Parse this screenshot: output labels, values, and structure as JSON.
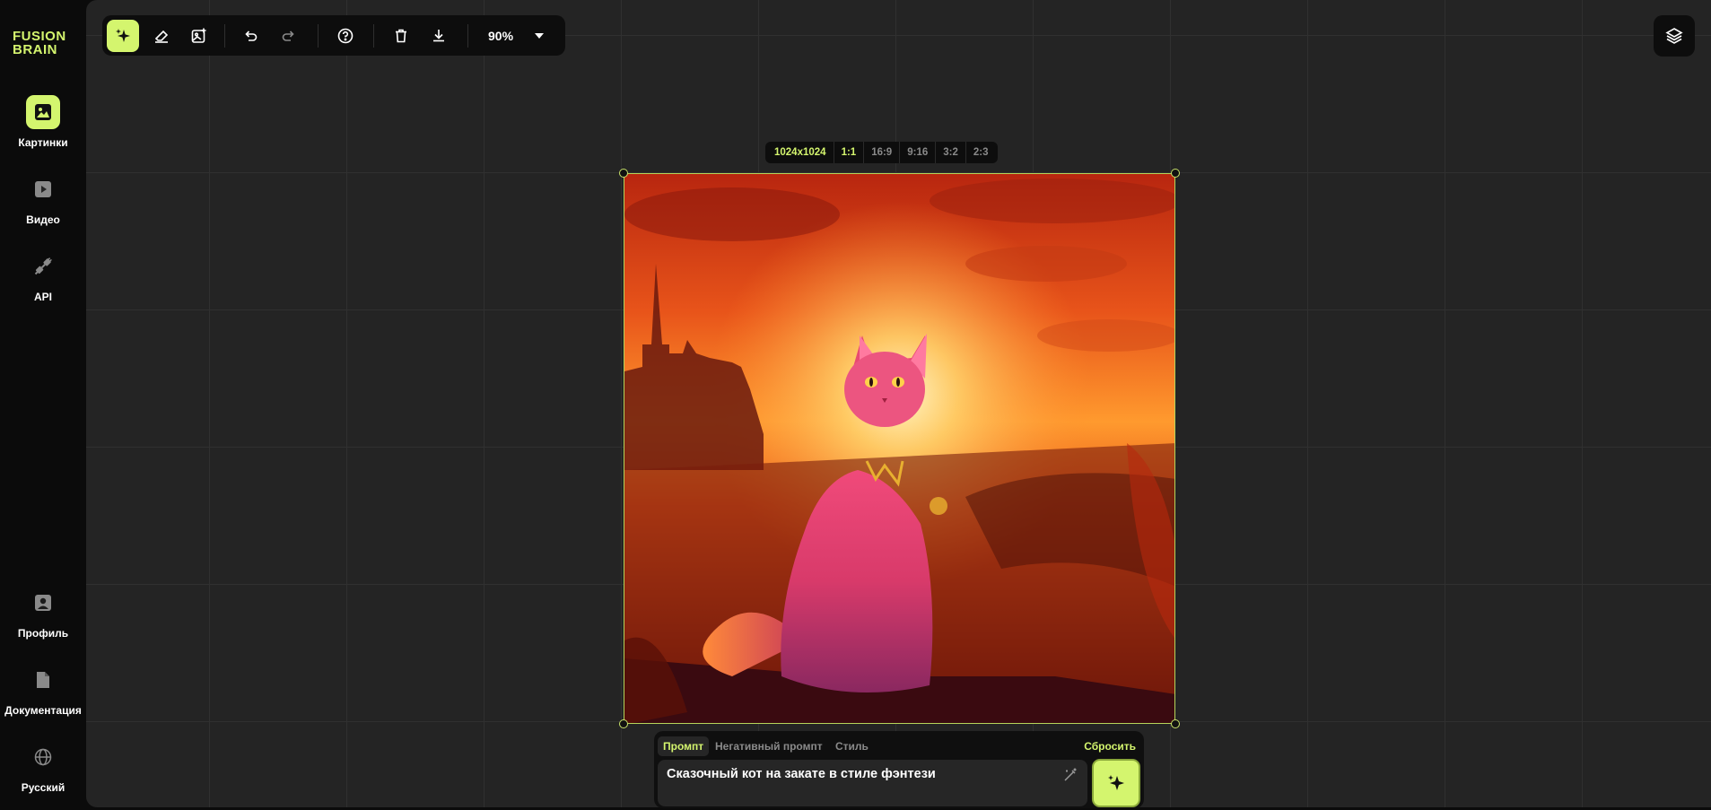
{
  "app": {
    "logo_line1": "FUSION",
    "logo_line2": "BRAIN"
  },
  "sidebar": {
    "top_items": [
      {
        "label": "Картинки",
        "icon": "image-icon",
        "active": true
      },
      {
        "label": "Видео",
        "icon": "video-icon",
        "active": false
      },
      {
        "label": "API",
        "icon": "plug-icon",
        "active": false
      }
    ],
    "bottom_items": [
      {
        "label": "Профиль",
        "icon": "profile-icon"
      },
      {
        "label": "Документация",
        "icon": "document-icon"
      },
      {
        "label": "Русский",
        "icon": "globe-icon"
      }
    ]
  },
  "toolbar": {
    "tools": [
      "generate-icon",
      "eraser-icon",
      "edit-image-icon",
      "undo-icon",
      "redo-icon",
      "help-icon",
      "delete-icon",
      "download-icon"
    ],
    "zoom": "90%"
  },
  "canvas": {
    "ratios": [
      "1024x1024",
      "1:1",
      "16:9",
      "9:16",
      "3:2",
      "2:3"
    ],
    "selected_ratios": [
      "1024x1024",
      "1:1"
    ]
  },
  "prompt_panel": {
    "tabs": [
      "Промпт",
      "Негативный промпт",
      "Стиль"
    ],
    "active_tab": "Промпт",
    "reset_label": "Сбросить",
    "prompt_text": "Сказочный кот на закате в стиле фэнтези"
  },
  "colors": {
    "accent": "#d4f56e",
    "background": "#0b0b0b",
    "canvas": "#242424"
  }
}
